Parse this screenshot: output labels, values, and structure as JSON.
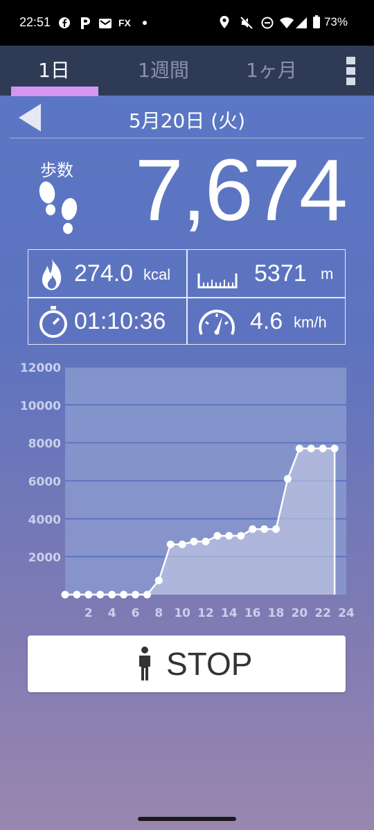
{
  "status_bar": {
    "time": "22:51",
    "notif_icons": [
      "facebook-icon",
      "p-app-icon",
      "mail-icon",
      "fx-icon",
      "dot-icon"
    ],
    "fx_label": "FX",
    "system_icons": [
      "location-icon",
      "mute-icon",
      "dnd-icon",
      "wifi-icon",
      "signal-icon",
      "battery-icon"
    ],
    "battery": "73%"
  },
  "tabs": [
    {
      "label": "1日",
      "active": true
    },
    {
      "label": "1週間",
      "active": false
    },
    {
      "label": "1ヶ月",
      "active": false
    }
  ],
  "date": "5月20日 (火)",
  "steps": {
    "title": "歩数",
    "value": "7,674"
  },
  "stats": {
    "calories": {
      "value": "274.0",
      "unit": "kcal"
    },
    "distance": {
      "value": "5371",
      "unit": "m"
    },
    "duration": {
      "value": "01:10:36"
    },
    "speed": {
      "value": "4.6",
      "unit": "km/h"
    }
  },
  "chart_data": {
    "type": "area",
    "x": [
      0,
      1,
      2,
      3,
      4,
      5,
      6,
      7,
      8,
      9,
      10,
      11,
      12,
      13,
      14,
      15,
      16,
      17,
      18,
      19,
      20,
      21,
      22,
      23
    ],
    "y": [
      0,
      0,
      0,
      0,
      0,
      0,
      0,
      0,
      750,
      2650,
      2650,
      2800,
      2800,
      3100,
      3100,
      3100,
      3450,
      3450,
      3450,
      6100,
      7700,
      7700,
      7700,
      7700
    ],
    "xticks": [
      "2",
      "4",
      "6",
      "8",
      "10",
      "12",
      "14",
      "16",
      "18",
      "20",
      "22",
      "24"
    ],
    "yticks": [
      "2000",
      "4000",
      "6000",
      "8000",
      "10000",
      "12000"
    ],
    "xlim": [
      0,
      24
    ],
    "ylim": [
      0,
      12000
    ],
    "grid": true,
    "colors": {
      "line": "#ffffff",
      "fill": "#c9cde6",
      "plot_bg": "#8b9bd0",
      "grid": "#5d74c2",
      "ticks": "#c9d0ea"
    }
  },
  "stop_button": {
    "label": "STOP"
  }
}
